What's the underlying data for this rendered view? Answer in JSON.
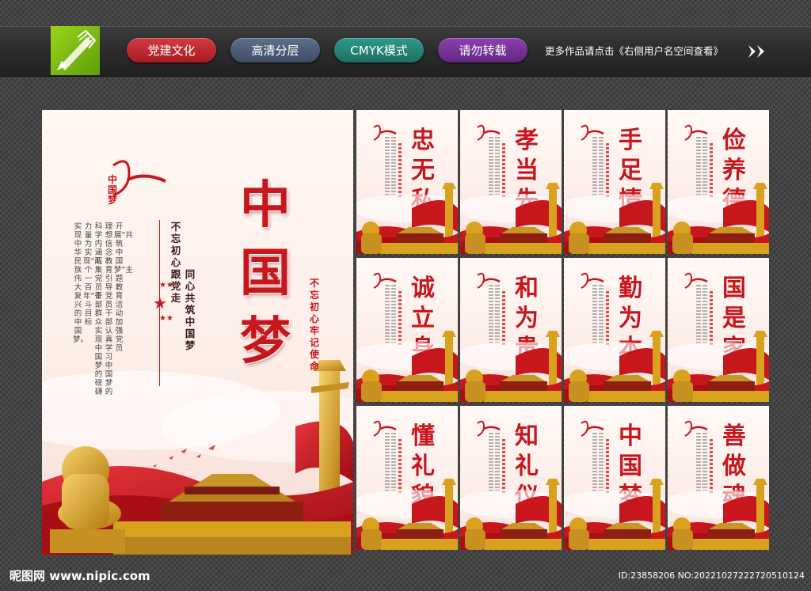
{
  "header": {
    "tags": [
      {
        "label": "党建文化",
        "color": "#c0262c"
      },
      {
        "label": "高清分层",
        "color": "#4a5a74"
      },
      {
        "label": "CMYK模式",
        "color": "#248574"
      },
      {
        "label": "请勿转载",
        "color": "#75309a"
      }
    ],
    "more_text": "更多作品请点击《右侧用户名空间查看》",
    "logo_icon": "pen-nib-icon",
    "arrow_icon": "double-chevron-right-icon"
  },
  "main_poster": {
    "title": "中国梦",
    "logo_text": "中国梦",
    "slogan_right": "同心共筑中国梦",
    "slogan_left": "不忘初心跟党走",
    "body_columns": [
      "开展“共筑中国梦”主题教育活动加强党员",
      "理想信念教育引导党员干部认真学习中国梦的",
      "科学内涵汇集党员干部群众实现中国梦的磅礴",
      "力量为实现“两个一百年”奋斗目标",
      "实现中华民族伟大复兴的中国梦。"
    ],
    "side_slogan_1": "不忘初心",
    "side_slogan_2": "牢记使命"
  },
  "cards": [
    {
      "title": "忠无私"
    },
    {
      "title": "孝当先"
    },
    {
      "title": "手足情"
    },
    {
      "title": "俭养德"
    },
    {
      "title": "诚立身"
    },
    {
      "title": "和为贵"
    },
    {
      "title": "勤为本"
    },
    {
      "title": "国是家"
    },
    {
      "title": "懂礼貌"
    },
    {
      "title": "知礼仪"
    },
    {
      "title": "中国梦"
    },
    {
      "title": "善做魂"
    }
  ],
  "footer": {
    "site": "昵图网 www.nipic.com",
    "id_text": "ID:23858206 NO:20221027222720510124"
  },
  "colors": {
    "accent_red": "#c8161d",
    "gold": "#d9a21e",
    "bg": "#3a3a3a"
  }
}
